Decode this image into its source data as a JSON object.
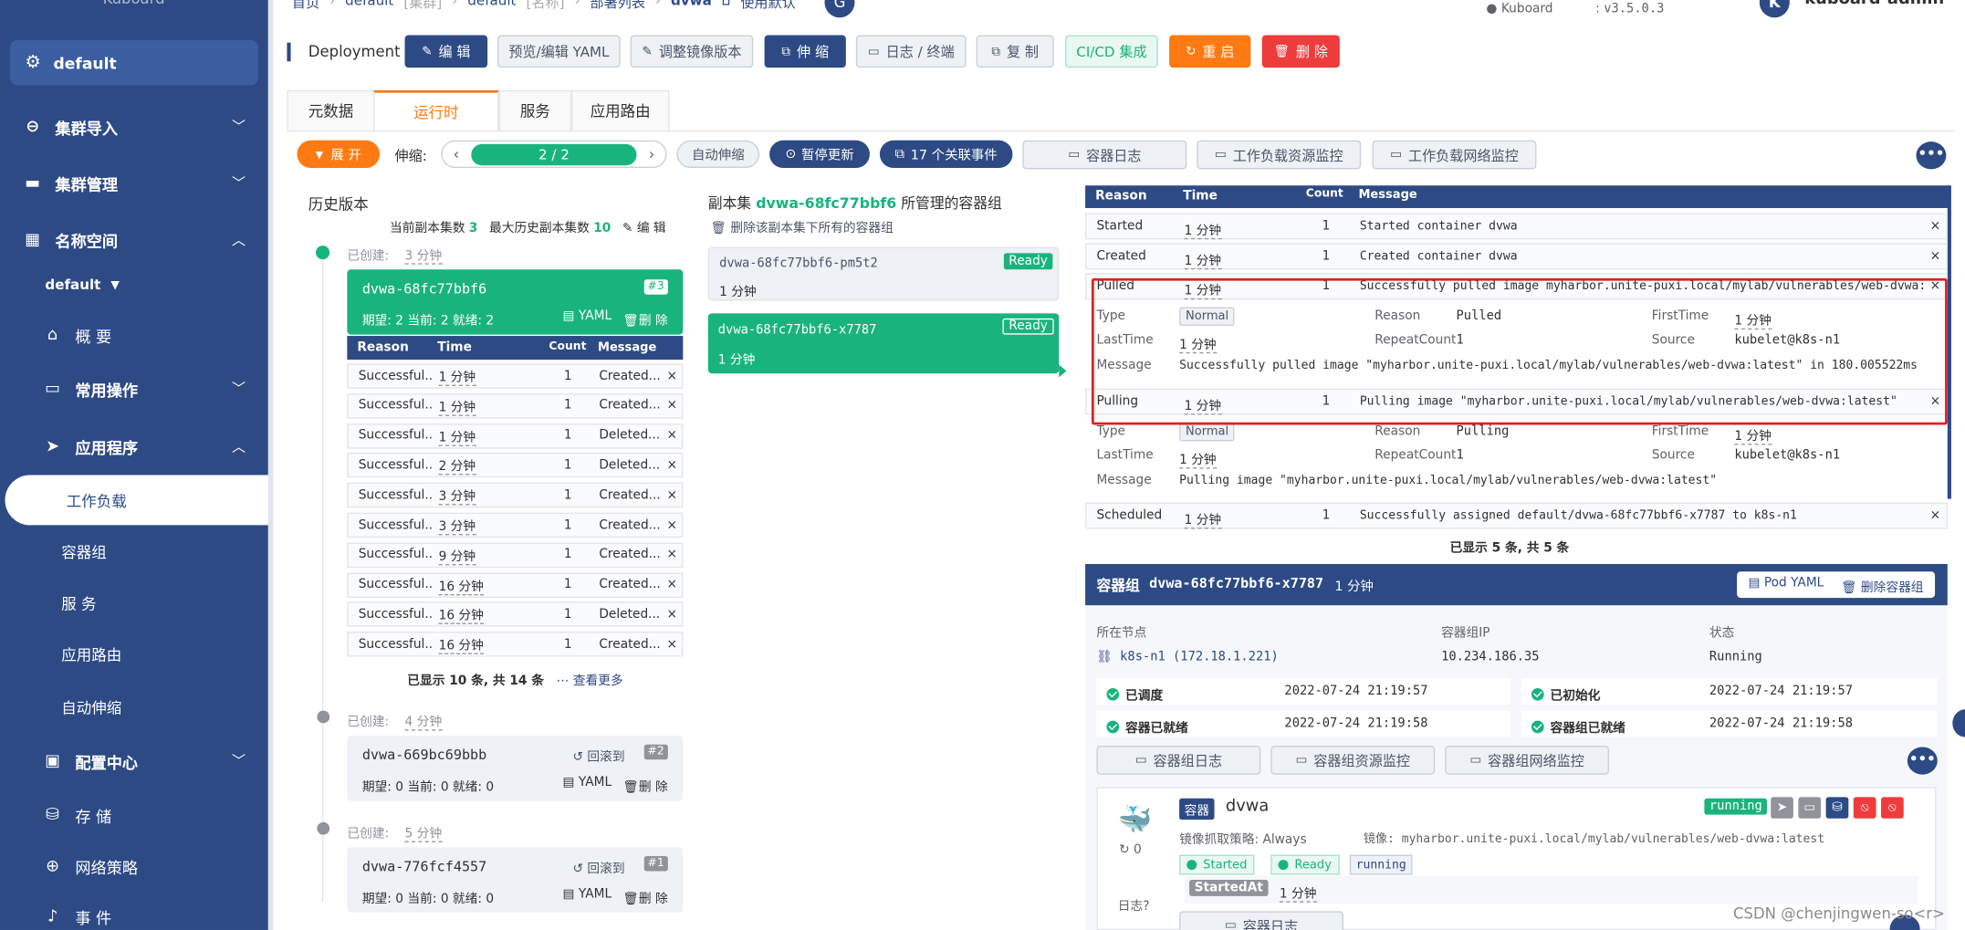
{
  "sidebar": {
    "title": "Kuboard",
    "cluster": "default",
    "items": [
      {
        "label": "集群导入"
      },
      {
        "label": "集群管理"
      },
      {
        "label": "名称空间"
      }
    ],
    "namespace": "default",
    "sub": {
      "overview": "概 要",
      "common_ops": "常用操作",
      "apps": "应用程序",
      "workload": "工作负载",
      "pods": "容器组",
      "services": "服 务",
      "routes": "应用路由",
      "autoscale": "自动伸缩",
      "config": "配置中心",
      "storage": "存 储",
      "netpolicy": "网络策略",
      "events": "事 件"
    }
  },
  "header": {
    "breadcrumb": [
      "首页",
      "default",
      "[集群]",
      "default",
      "[名称]",
      "部署列表",
      "dvwa",
      "使用默认"
    ],
    "kuboard_label": "Kuboard",
    "version": "v3.5.0.3",
    "user": "kuboard-admin"
  },
  "toolbar": {
    "kind": "Deployment",
    "edit": "编 辑",
    "preview_yaml": "预览/编辑 YAML",
    "adjust_image": "调整镜像版本",
    "scale": "伸 缩",
    "logs": "日志 / 终端",
    "copy": "复 制",
    "cicd": "CI/CD 集成",
    "restart": "重 启",
    "delete": "删 除"
  },
  "tabs": {
    "metadata": "元数据",
    "runtime": "运行时",
    "service": "服务",
    "route": "应用路由"
  },
  "runtime_bar": {
    "expand": "展 开",
    "scale_label": "伸缩:",
    "replicas": "2 / 2",
    "autoscale": "自动伸缩",
    "pause": "暂停更新",
    "events": "17 个关联事件",
    "container_logs": "容器日志",
    "workload_monitor": "工作负载资源监控",
    "network_monitor": "工作负载网络监控"
  },
  "history": {
    "title": "历史版本",
    "current_label": "当前副本集数",
    "current_value": "3",
    "max_label": "最大历史副本集数",
    "max_value": "10",
    "edit": "编 辑",
    "created_label": "已创建:",
    "rs1": {
      "age": "3 分钟",
      "name": "dvwa-68fc77bbf6",
      "rev": "#3",
      "status": "期望: 2 当前: 2 就绪: 2",
      "yaml": "YAML",
      "delete": "删 除"
    },
    "events_header": {
      "reason": "Reason",
      "time": "Time",
      "count": "Count",
      "message": "Message"
    },
    "events": [
      {
        "reason": "Successful...",
        "time": "1 分钟",
        "count": "1",
        "message": "Created..."
      },
      {
        "reason": "Successful...",
        "time": "1 分钟",
        "count": "1",
        "message": "Created..."
      },
      {
        "reason": "Successful...",
        "time": "1 分钟",
        "count": "1",
        "message": "Deleted..."
      },
      {
        "reason": "Successful...",
        "time": "2 分钟",
        "count": "1",
        "message": "Deleted..."
      },
      {
        "reason": "Successful...",
        "time": "3 分钟",
        "count": "1",
        "message": "Created..."
      },
      {
        "reason": "Successful...",
        "time": "3 分钟",
        "count": "1",
        "message": "Created..."
      },
      {
        "reason": "Successful...",
        "time": "9 分钟",
        "count": "1",
        "message": "Created..."
      },
      {
        "reason": "Successful...",
        "time": "16 分钟",
        "count": "1",
        "message": "Created..."
      },
      {
        "reason": "Successful...",
        "time": "16 分钟",
        "count": "1",
        "message": "Deleted..."
      },
      {
        "reason": "Successful...",
        "time": "16 分钟",
        "count": "1",
        "message": "Created..."
      }
    ],
    "shown": "已显示 10 条, 共 14 条",
    "more": "查看更多",
    "rs2": {
      "age": "4 分钟",
      "name": "dvwa-669bc69bbb",
      "rollback": "回滚到",
      "rev": "#2",
      "status": "期望: 0 当前: 0 就绪: 0",
      "yaml": "YAML",
      "delete": "删 除"
    },
    "rs3": {
      "age": "5 分钟",
      "name": "dvwa-776fcf4557",
      "rollback": "回滚到",
      "rev": "#1",
      "status": "期望: 0 当前: 0 就绪: 0",
      "yaml": "YAML",
      "delete": "删 除"
    }
  },
  "replicaset": {
    "prefix": "副本集",
    "name": "dvwa-68fc77bbf6",
    "suffix": "所管理的容器组",
    "delete_all": "删除该副本集下所有的容器组",
    "pods": [
      {
        "name": "dvwa-68fc77bbf6-pm5t2",
        "age": "1 分钟",
        "status": "Ready"
      },
      {
        "name": "dvwa-68fc77bbf6-x7787",
        "age": "1 分钟",
        "status": "Ready"
      }
    ]
  },
  "events_table": {
    "header": {
      "reason": "Reason",
      "time": "Time",
      "count": "Count",
      "message": "Message"
    },
    "rows": [
      {
        "reason": "Started",
        "time": "1 分钟",
        "count": "1",
        "message": "Started container dvwa"
      },
      {
        "reason": "Created",
        "time": "1 分钟",
        "count": "1",
        "message": "Created container dvwa"
      },
      {
        "reason": "Pulled",
        "time": "1 分钟",
        "count": "1",
        "message": "Successfully pulled image  myharbor.unite-puxi.local/mylab/vulnerables/web-dvwa:la..."
      },
      {
        "reason": "Pulling",
        "time": "1 分钟",
        "count": "1",
        "message": "Pulling image \"myharbor.unite-puxi.local/mylab/vulnerables/web-dvwa:latest\""
      },
      {
        "reason": "Scheduled",
        "time": "1 分钟",
        "count": "1",
        "message": "Successfully assigned default/dvwa-68fc77bbf6-x7787 to k8s-n1"
      }
    ],
    "labels": {
      "type": "Type",
      "reason": "Reason",
      "firsttime": "FirstTime",
      "lasttime": "LastTime",
      "repeat": "RepeatCount",
      "source": "Source",
      "message": "Message"
    },
    "pulled_detail": {
      "type": "Normal",
      "reason": "Pulled",
      "firsttime": "1 分钟",
      "lasttime": "1 分钟",
      "repeat": "1",
      "source": "kubelet@k8s-n1",
      "message": "Successfully pulled image \"myharbor.unite-puxi.local/mylab/vulnerables/web-dvwa:latest\" in 180.005522ms"
    },
    "pulling_detail": {
      "type": "Normal",
      "reason": "Pulling",
      "firsttime": "1 分钟",
      "lasttime": "1 分钟",
      "repeat": "1",
      "source": "kubelet@k8s-n1",
      "message": "Pulling image \"myharbor.unite-puxi.local/mylab/vulnerables/web-dvwa:latest\""
    },
    "shown": "已显示 5 条, 共 5 条"
  },
  "pod": {
    "title": "容器组",
    "name": "dvwa-68fc77bbf6-x7787",
    "age": "1 分钟",
    "yaml": "Pod YAML",
    "delete": "删除容器组",
    "node_label": "所在节点",
    "node_value": "k8s-n1 (172.18.1.221)",
    "ip_label": "容器组IP",
    "ip_value": "10.234.186.35",
    "status_label": "状态",
    "status_value": "Running",
    "conditions": [
      {
        "label": "已调度",
        "time": "2022-07-24 21:19:57"
      },
      {
        "label": "已初始化",
        "time": "2022-07-24 21:19:57"
      },
      {
        "label": "容器已就绪",
        "time": "2022-07-24 21:19:58"
      },
      {
        "label": "容器组已就绪",
        "time": "2022-07-24 21:19:58"
      }
    ],
    "btn_logs": "容器组日志",
    "btn_resource": "容器组资源监控",
    "btn_network": "容器组网络监控"
  },
  "container": {
    "tag": "容器",
    "name": "dvwa",
    "state": "running",
    "restarts": "0",
    "pull_policy": "镜像抓取策略: Always",
    "image": "镜像: myharbor.unite-puxi.local/mylab/vulnerables/web-dvwa:latest",
    "started": "Started",
    "ready": "Ready",
    "running": "running",
    "started_at_label": "StartedAt",
    "started_at_value": "1 分钟",
    "logs_label": "日志",
    "logs_btn": "容器日志"
  },
  "watermark": "CSDN @chenjingwen-so<r>",
  "colors": {
    "primary": "#2d4a85",
    "accent": "#ff7a12",
    "success": "#19b47c",
    "danger": "#ee3b3b"
  }
}
